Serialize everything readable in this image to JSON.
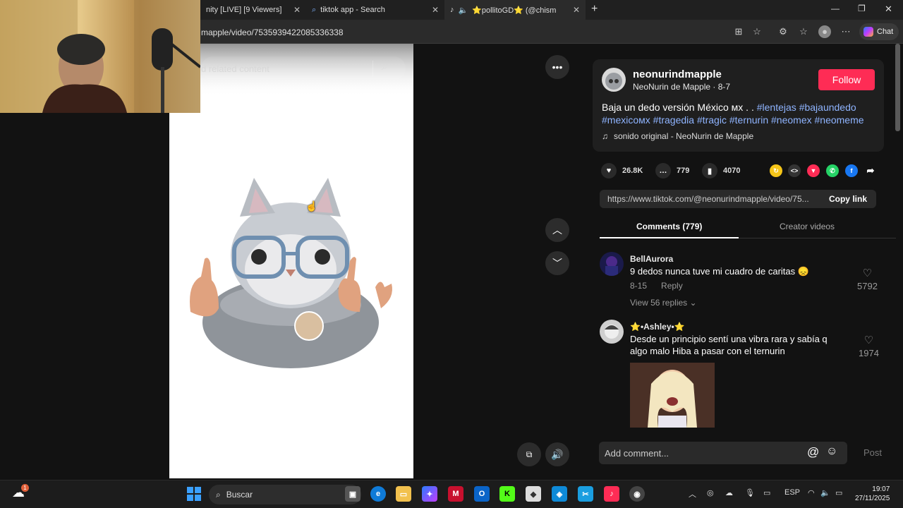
{
  "browser": {
    "tabs": [
      {
        "label": "nity [LIVE] [9 Viewers]"
      },
      {
        "label": "tiktok app - Search"
      },
      {
        "label": "⭐pollitoGD⭐ (@chismoso"
      }
    ],
    "url": "mapple/video/7535939422085336338",
    "chat_label": "Chat"
  },
  "video": {
    "search_placeholder": "d related content"
  },
  "post": {
    "username": "neonurindmapple",
    "display_name": "NeoNurin de Mapple",
    "date": "8-7",
    "follow_label": "Follow",
    "desc_text": "Baja un dedo versión México ᴍx . .",
    "hashtags_line1": [
      "#lentejas",
      "#bajaundedo"
    ],
    "hashtags_line2": [
      "#mexicoᴍx",
      "#tragedia",
      "#tragic",
      "#ternurin",
      "#neomex",
      "#neomeme"
    ],
    "sound": "sonido original - NeoNurin de Mapple",
    "likes": "26.8K",
    "comments": "779",
    "saves": "4070",
    "link": "https://www.tiktok.com/@neonurindmapple/video/75...",
    "copy_label": "Copy link"
  },
  "tabs": {
    "comments": "Comments (779)",
    "creator": "Creator videos"
  },
  "comments": [
    {
      "name": "BellAurora",
      "text": "9 dedos nunca tuve mi cuadro de caritas 😞",
      "date": "8-15",
      "reply": "Reply",
      "likes": "5792",
      "view_replies": "View 56 replies"
    },
    {
      "name": "⭐•Ashley•⭐",
      "text_line1": "Desde un principio sentí una vibra rara y sabía q",
      "text_line2": "algo malo Hiba a pasar con el ternurin",
      "likes": "1974"
    }
  ],
  "comment_box": {
    "placeholder": "Add comment...",
    "post_label": "Post"
  },
  "taskbar": {
    "search_label": "Buscar",
    "language": "ESP",
    "time": "19:07",
    "date": "27/11/2025",
    "notif_count": "1"
  },
  "colors": {
    "accent": "#fe2c55",
    "hashtag": "#8fb4ff",
    "background": "#121212"
  }
}
